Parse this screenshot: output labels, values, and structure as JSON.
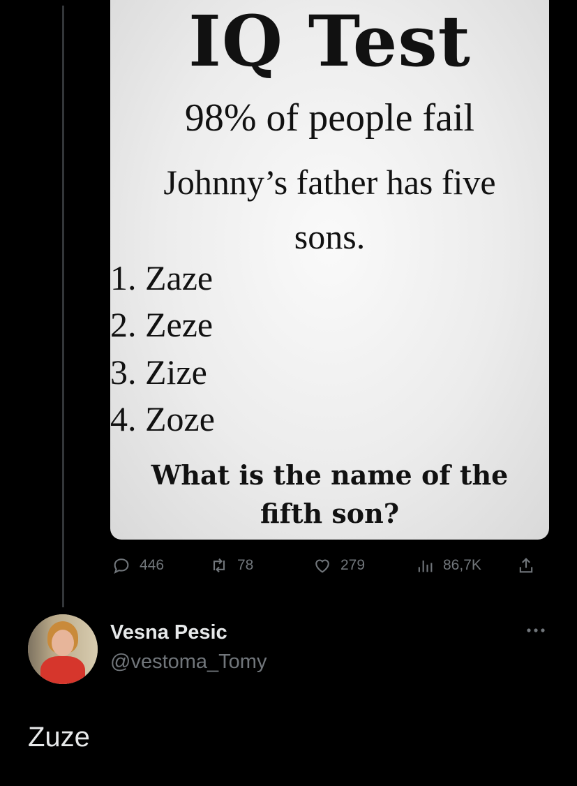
{
  "meme": {
    "title": "IQ Test",
    "subtitle": "98% of people fail",
    "question_line1": "Johnny’s father has five",
    "question_line2": "sons.",
    "sons": [
      "1. Zaze",
      "2. Zeze",
      "3. Zize",
      "4. Zoze"
    ],
    "ask_line1": "What is the name of the",
    "ask_line2": "fifth son?"
  },
  "actions": {
    "replies": "446",
    "reposts": "78",
    "likes": "279",
    "views": "86,7K"
  },
  "reply": {
    "author_name": "Vesna Pesic",
    "author_handle": "@vestoma_Tomy",
    "text": "Zuze"
  },
  "colors": {
    "background": "#000000",
    "text": "#e7e9ea",
    "muted": "#71767b"
  }
}
